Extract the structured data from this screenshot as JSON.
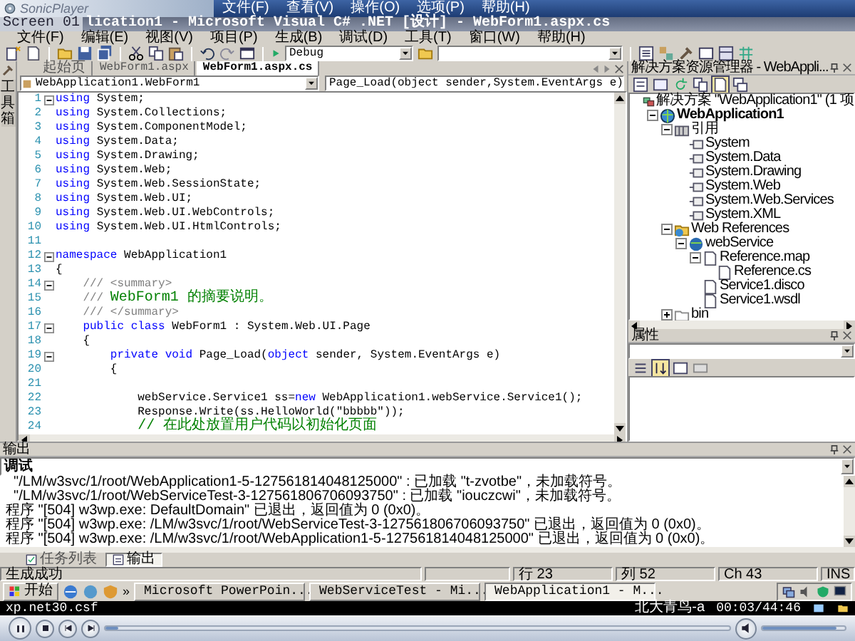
{
  "player": {
    "logo": "SonicPlayer",
    "menu": [
      "文件(F)",
      "查看(V)",
      "操作(O)",
      "选项(P)",
      "帮助(H)"
    ],
    "file": "xp.net30.csf",
    "channel": "北大青鸟-a",
    "time": "00:03/44:46",
    "seek": {
      "level": 0.02
    },
    "volume": {
      "level": 0.9
    }
  },
  "window": {
    "screen_label": "Screen 01",
    "title": "lication1 - Microsoft Visual C# .NET [设计] - WebForm1.aspx.cs"
  },
  "menu": [
    "文件(F)",
    "编辑(E)",
    "视图(V)",
    "项目(P)",
    "生成(B)",
    "调试(D)",
    "工具(T)",
    "窗口(W)",
    "帮助(H)"
  ],
  "toolbar": {
    "configuration": "Debug"
  },
  "toolbox_label": "工具箱",
  "tabs": [
    {
      "label": "起始页",
      "selected": false
    },
    {
      "label": "WebForm1.aspx",
      "selected": false
    },
    {
      "label": "WebForm1.aspx.cs",
      "selected": true
    }
  ],
  "class_selector": "WebApplication1.WebForm1",
  "member_selector": "Page_Load(object sender,System.EventArgs e)",
  "code": [
    {
      "number": "1",
      "fold": true,
      "tokens": [
        {
          "kind": "keyword",
          "text": "using"
        },
        {
          "kind": "plain",
          "text": " System;"
        }
      ]
    },
    {
      "number": "2",
      "fold": false,
      "tokens": [
        {
          "kind": "keyword",
          "text": "using"
        },
        {
          "kind": "plain",
          "text": " System.Collections;"
        }
      ]
    },
    {
      "number": "3",
      "fold": false,
      "tokens": [
        {
          "kind": "keyword",
          "text": "using"
        },
        {
          "kind": "plain",
          "text": " System.ComponentModel;"
        }
      ]
    },
    {
      "number": "4",
      "fold": false,
      "tokens": [
        {
          "kind": "keyword",
          "text": "using"
        },
        {
          "kind": "plain",
          "text": " System.Data;"
        }
      ]
    },
    {
      "number": "5",
      "fold": false,
      "tokens": [
        {
          "kind": "keyword",
          "text": "using"
        },
        {
          "kind": "plain",
          "text": " System.Drawing;"
        }
      ]
    },
    {
      "number": "6",
      "fold": false,
      "tokens": [
        {
          "kind": "keyword",
          "text": "using"
        },
        {
          "kind": "plain",
          "text": " System.Web;"
        }
      ]
    },
    {
      "number": "7",
      "fold": false,
      "tokens": [
        {
          "kind": "keyword",
          "text": "using"
        },
        {
          "kind": "plain",
          "text": " System.Web.SessionState;"
        }
      ]
    },
    {
      "number": "8",
      "fold": false,
      "tokens": [
        {
          "kind": "keyword",
          "text": "using"
        },
        {
          "kind": "plain",
          "text": " System.Web.UI;"
        }
      ]
    },
    {
      "number": "9",
      "fold": false,
      "tokens": [
        {
          "kind": "keyword",
          "text": "using"
        },
        {
          "kind": "plain",
          "text": " System.Web.UI.WebControls;"
        }
      ]
    },
    {
      "number": "10",
      "fold": false,
      "tokens": [
        {
          "kind": "keyword",
          "text": "using"
        },
        {
          "kind": "plain",
          "text": " System.Web.UI.HtmlControls;"
        }
      ]
    },
    {
      "number": "11",
      "fold": false
    },
    {
      "number": "12",
      "fold": true,
      "tokens": [
        {
          "kind": "keyword",
          "text": "namespace"
        },
        {
          "kind": "plain",
          "text": " WebApplication1"
        }
      ]
    },
    {
      "number": "13",
      "fold": false,
      "tokens": [
        {
          "kind": "plain",
          "text": "{"
        }
      ]
    },
    {
      "number": "14",
      "fold": true,
      "tokens": [
        {
          "kind": "doc",
          "text": "    /// <summary>"
        }
      ]
    },
    {
      "number": "15",
      "fold": false,
      "tokens": [
        {
          "kind": "doc",
          "text": "    ///"
        },
        {
          "kind": "comment",
          "text": " WebForm1 的摘要说明。"
        }
      ]
    },
    {
      "number": "16",
      "fold": false,
      "tokens": [
        {
          "kind": "doc",
          "text": "    /// </summary>"
        }
      ]
    },
    {
      "number": "17",
      "fold": true,
      "tokens": [
        {
          "kind": "keyword",
          "text": "    public"
        },
        {
          "kind": "keyword",
          "text": " class"
        },
        {
          "kind": "plain",
          "text": " WebForm1 : System.Web.UI.Page"
        }
      ]
    },
    {
      "number": "18",
      "fold": false,
      "tokens": [
        {
          "kind": "plain",
          "text": "    {"
        }
      ]
    },
    {
      "number": "19",
      "fold": true,
      "tokens": [
        {
          "kind": "keyword",
          "text": "        private"
        },
        {
          "kind": "keyword",
          "text": " void"
        },
        {
          "kind": "plain",
          "text": " Page_Load("
        },
        {
          "kind": "keyword",
          "text": "object"
        },
        {
          "kind": "plain",
          "text": " sender, System.EventArgs e)"
        }
      ]
    },
    {
      "number": "20",
      "fold": false,
      "tokens": [
        {
          "kind": "plain",
          "text": "        {"
        }
      ]
    },
    {
      "number": "21",
      "fold": false
    },
    {
      "number": "22",
      "fold": false,
      "tokens": [
        {
          "kind": "plain",
          "text": "            webService.Service1 ss="
        },
        {
          "kind": "keyword",
          "text": "new"
        },
        {
          "kind": "plain",
          "text": " WebApplication1.webService.Service1();"
        }
      ]
    },
    {
      "number": "23",
      "fold": false,
      "tokens": [
        {
          "kind": "plain",
          "text": "            Response.Write(ss.HelloWorld(\"bbbbb\"));"
        }
      ]
    },
    {
      "number": "24",
      "fold": false,
      "tokens": [
        {
          "kind": "comment",
          "text": "            // 在此处放置用户代码以初始化页面"
        }
      ]
    }
  ],
  "solution_explorer": {
    "title": "解决方案资源管理器 - WebAppli...",
    "tree": [
      {
        "kind": "solution",
        "label": "解决方案 \"WebApplication1\" (1 项",
        "children": [
          {
            "kind": "project",
            "label": "WebApplication1",
            "expanded": true,
            "children": [
              {
                "kind": "references",
                "label": "引用",
                "expanded": true,
                "children": [
                  {
                    "kind": "reference",
                    "label": "System"
                  },
                  {
                    "kind": "reference",
                    "label": "System.Data"
                  },
                  {
                    "kind": "reference",
                    "label": "System.Drawing"
                  },
                  {
                    "kind": "reference",
                    "label": "System.Web"
                  },
                  {
                    "kind": "reference",
                    "label": "System.Web.Services"
                  },
                  {
                    "kind": "reference",
                    "label": "System.XML"
                  }
                ]
              },
              {
                "kind": "web-references",
                "label": "Web References",
                "expanded": true,
                "children": [
                  {
                    "kind": "service",
                    "label": "webService",
                    "expanded": true,
                    "children": [
                      {
                        "kind": "file",
                        "label": "Reference.map",
                        "expanded": true,
                        "children": [
                          {
                            "kind": "file",
                            "label": "Reference.cs"
                          }
                        ]
                      },
                      {
                        "kind": "file",
                        "label": "Service1.disco"
                      },
                      {
                        "kind": "file",
                        "label": "Service1.wsdl"
                      }
                    ]
                  }
                ]
              },
              {
                "kind": "folder",
                "label": "bin",
                "expanded": false
              }
            ]
          }
        ]
      }
    ]
  },
  "properties": {
    "title": "属性"
  },
  "output": {
    "title": "输出",
    "source": "调试",
    "lines": [
      "  \"/LM/w3svc/1/root/WebApplication1-5-127561814048125000\" : 已加载 \"t-zvotbe\"，未加载符号。",
      "  \"/LM/w3svc/1/root/WebServiceTest-3-127561806706093750\" : 已加载 \"iouczcwi\"，未加载符号。",
      "程序 \"[504] w3wp.exe: DefaultDomain\" 已退出，返回值为 0 (0x0)。",
      "程序 \"[504] w3wp.exe: /LM/w3svc/1/root/WebServiceTest-3-127561806706093750\" 已退出，返回值为 0 (0x0)。",
      "程序 \"[504] w3wp.exe: /LM/w3svc/1/root/WebApplication1-5-127561814048125000\" 已退出，返回值为 0 (0x0)。"
    ],
    "tabs": [
      {
        "label": "任务列表",
        "selected": false
      },
      {
        "label": "输出",
        "selected": true
      }
    ]
  },
  "status_bar": {
    "message": "生成成功",
    "line": "行 23",
    "column": "列 52",
    "char": "Ch 43",
    "mode": "INS"
  },
  "taskbar": {
    "start": "开始",
    "more": "»",
    "buttons": [
      {
        "label": "Microsoft PowerPoin...",
        "selected": false
      },
      {
        "label": "WebServiceTest - Mi...",
        "selected": false
      },
      {
        "label": "WebApplication1 - M...",
        "selected": true
      }
    ]
  }
}
